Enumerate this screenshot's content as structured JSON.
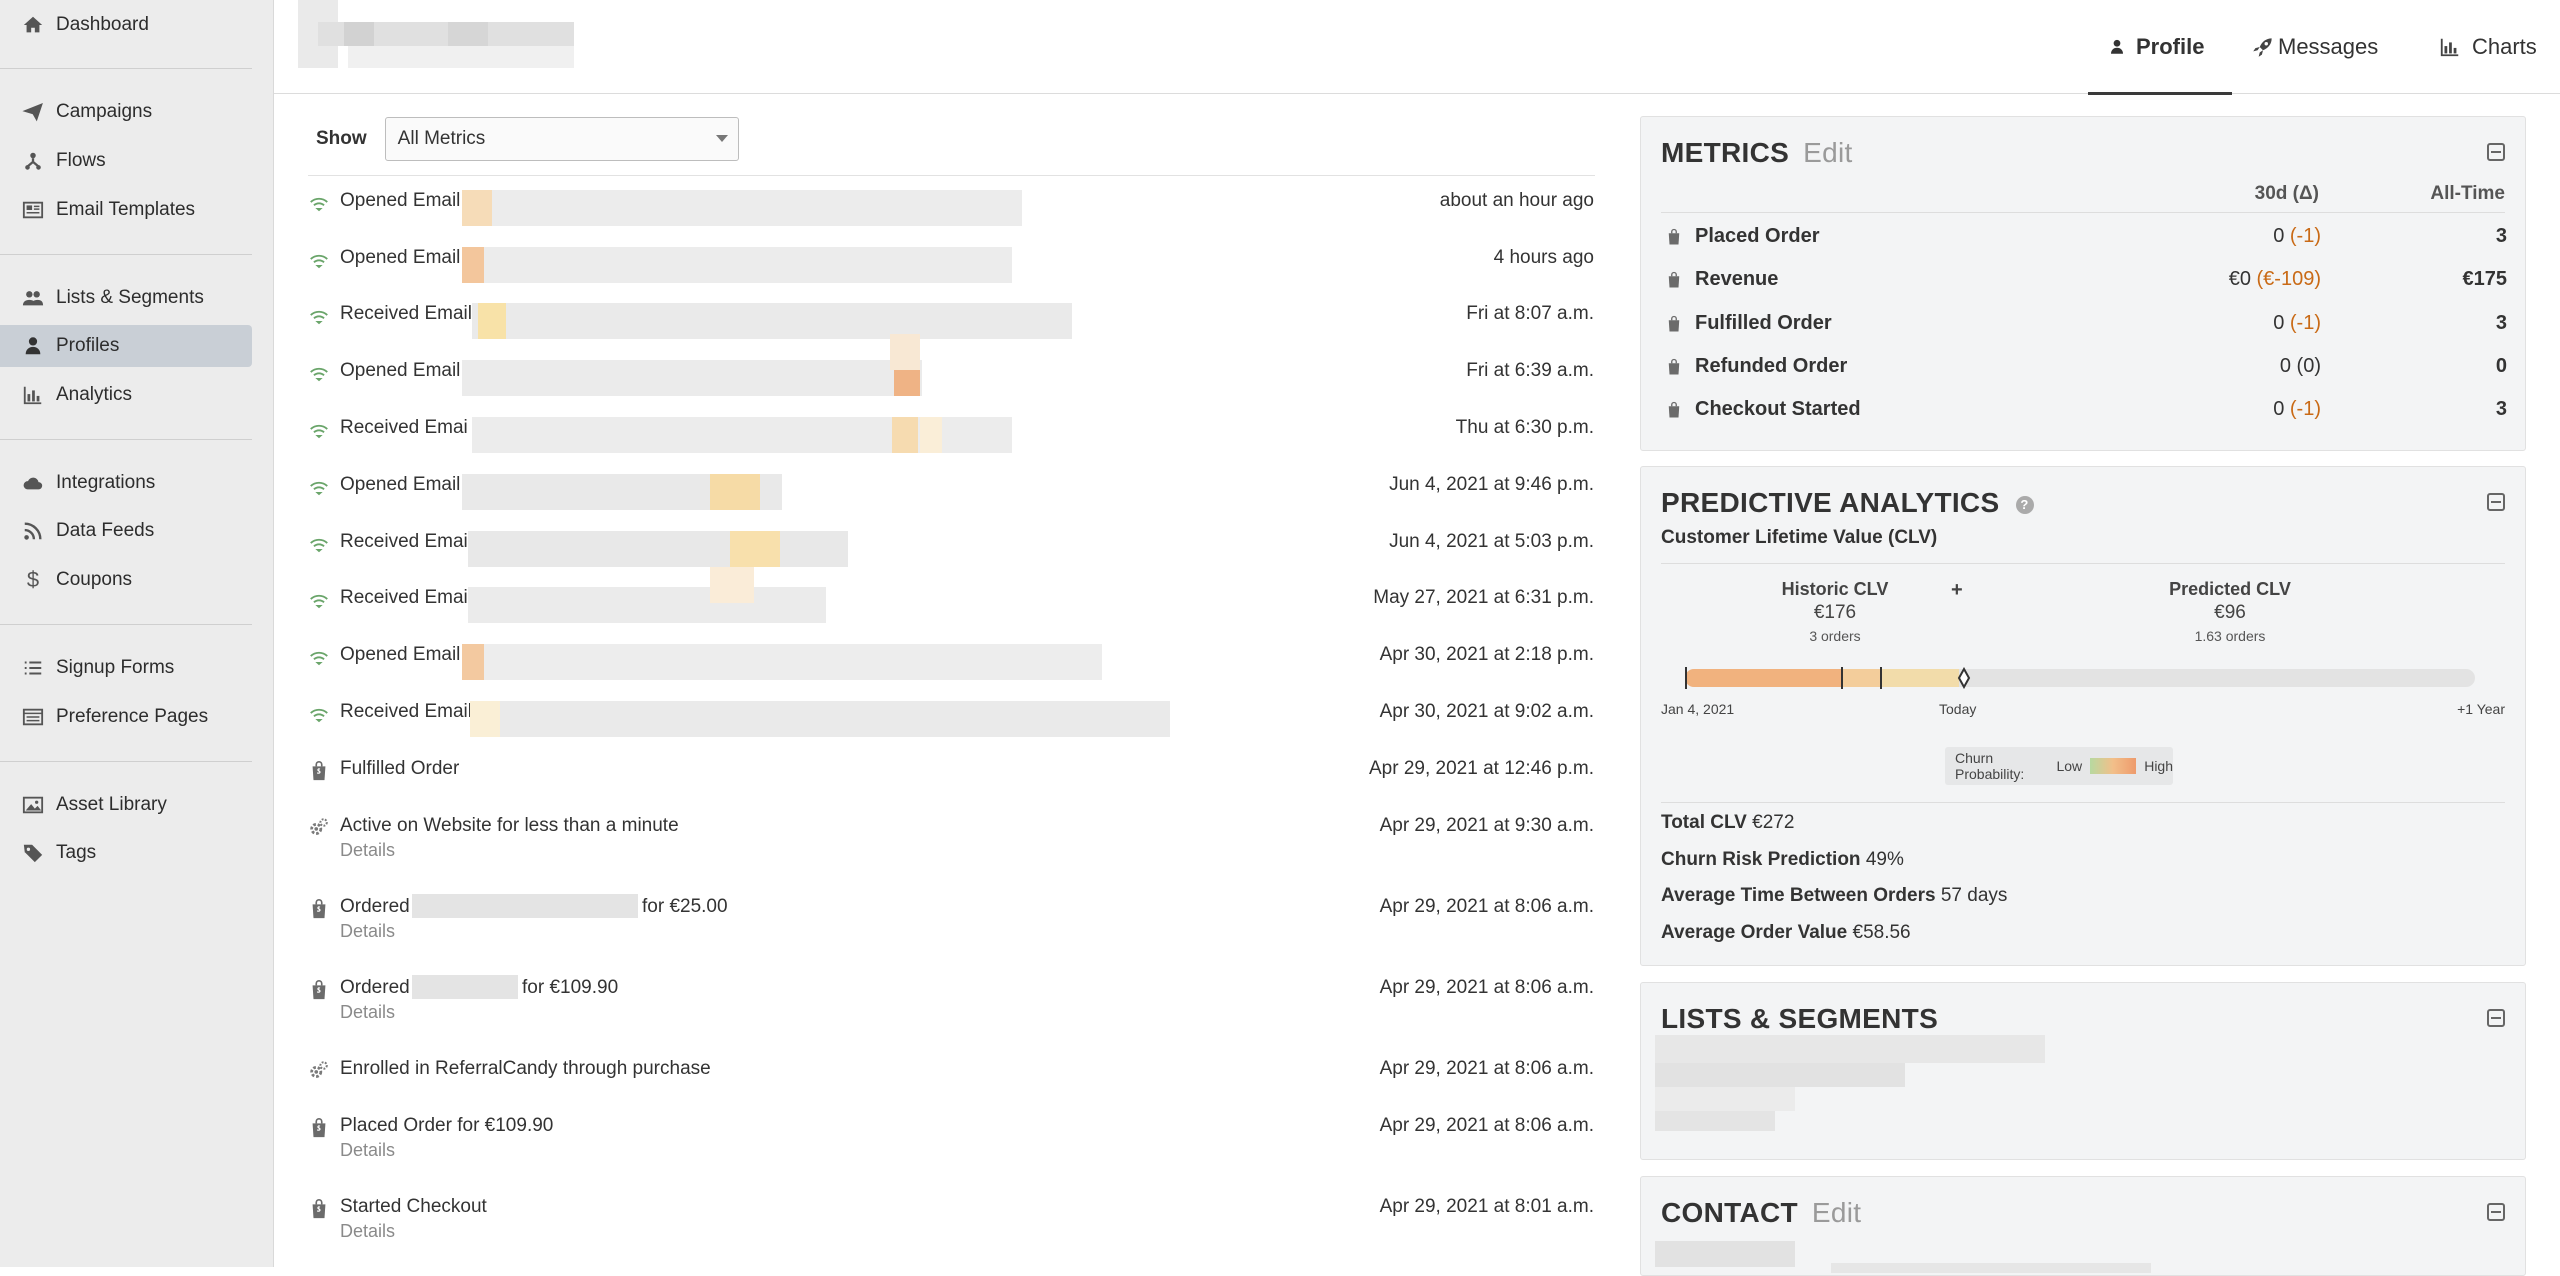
{
  "sidebar": {
    "items": [
      {
        "label": "Dashboard",
        "icon": "home-icon"
      },
      {
        "label": "Campaigns",
        "icon": "paper-plane-icon"
      },
      {
        "label": "Flows",
        "icon": "flows-icon"
      },
      {
        "label": "Email Templates",
        "icon": "newspaper-icon"
      },
      {
        "label": "Lists & Segments",
        "icon": "users-icon"
      },
      {
        "label": "Profiles",
        "icon": "user-icon"
      },
      {
        "label": "Analytics",
        "icon": "bar-chart-icon"
      },
      {
        "label": "Integrations",
        "icon": "cloud-icon"
      },
      {
        "label": "Data Feeds",
        "icon": "rss-icon"
      },
      {
        "label": "Coupons",
        "icon": "dollar-icon"
      },
      {
        "label": "Signup Forms",
        "icon": "list-icon"
      },
      {
        "label": "Preference Pages",
        "icon": "window-icon"
      },
      {
        "label": "Asset Library",
        "icon": "image-icon"
      },
      {
        "label": "Tags",
        "icon": "tag-icon"
      }
    ],
    "active": "Profiles"
  },
  "header": {
    "tabs": [
      {
        "label": "Profile",
        "icon": "user-icon"
      },
      {
        "label": "Messages",
        "icon": "rocket-icon"
      },
      {
        "label": "Charts",
        "icon": "bar-chart-icon"
      }
    ],
    "active_tab": "Profile"
  },
  "feed": {
    "show_label": "Show",
    "metric_filter": "All Metrics",
    "events": [
      {
        "title": "Opened Email",
        "time": "about an hour ago",
        "icon": "email-opened-icon"
      },
      {
        "title": "Opened Email",
        "time": "4 hours ago",
        "icon": "email-opened-icon"
      },
      {
        "title": "Received Email",
        "time": "Fri at 8:07 a.m.",
        "icon": "email-received-icon"
      },
      {
        "title": "Opened Email",
        "time": "Fri at 6:39 a.m.",
        "icon": "email-opened-icon"
      },
      {
        "title": "Received Emai",
        "time": "Thu at 6:30 p.m.",
        "icon": "email-received-icon"
      },
      {
        "title": "Opened Email",
        "time": "Jun 4, 2021 at 9:46 p.m.",
        "icon": "email-opened-icon"
      },
      {
        "title": "Received Email",
        "time": "Jun 4, 2021 at 5:03 p.m.",
        "icon": "email-received-icon"
      },
      {
        "title": "Received Email",
        "time": "May 27, 2021 at 6:31 p.m.",
        "icon": "email-received-icon"
      },
      {
        "title": "Opened Email",
        "time": "Apr 30, 2021 at 2:18 p.m.",
        "icon": "email-opened-icon"
      },
      {
        "title": "Received Email",
        "time": "Apr 30, 2021 at 9:02 a.m.",
        "icon": "email-received-icon"
      },
      {
        "title": "Fulfilled Order",
        "time": "Apr 29, 2021 at 12:46 p.m.",
        "icon": "shopify-icon"
      },
      {
        "title": "Active on Website for less than a minute",
        "time": "Apr 29, 2021 at 9:30 a.m.",
        "details": "Details",
        "icon": "gears-icon"
      },
      {
        "title": "Ordered",
        "title_suffix": "for €25.00",
        "time": "Apr 29, 2021 at 8:06 a.m.",
        "details": "Details",
        "icon": "shopify-icon"
      },
      {
        "title": "Ordered",
        "title_suffix": "for €109.90",
        "time": "Apr 29, 2021 at 8:06 a.m.",
        "details": "Details",
        "icon": "shopify-icon"
      },
      {
        "title": "Enrolled in ReferralCandy through purchase",
        "time": "Apr 29, 2021 at 8:06 a.m.",
        "icon": "gears-icon"
      },
      {
        "title": "Placed Order for €109.90",
        "time": "Apr 29, 2021 at 8:06 a.m.",
        "details": "Details",
        "icon": "shopify-icon"
      },
      {
        "title": "Started Checkout",
        "time": "Apr 29, 2021 at 8:01 a.m.",
        "details": "Details",
        "icon": "shopify-icon"
      }
    ]
  },
  "metrics": {
    "title": "METRICS",
    "edit_label": "Edit",
    "col_30d": "30d (Δ)",
    "col_all": "All-Time",
    "rows": [
      {
        "name": "Placed Order",
        "d30": "0",
        "delta": "(-1)",
        "all": "3",
        "delta_colored": true
      },
      {
        "name": "Revenue",
        "d30": "€0",
        "delta": "(€-109)",
        "all": "€175",
        "delta_colored": true
      },
      {
        "name": "Fulfilled Order",
        "d30": "0",
        "delta": "(-1)",
        "all": "3",
        "delta_colored": true
      },
      {
        "name": "Refunded Order",
        "d30": "0",
        "delta": "(0)",
        "all": "0",
        "delta_colored": false
      },
      {
        "name": "Checkout Started",
        "d30": "0",
        "delta": "(-1)",
        "all": "3",
        "delta_colored": true
      }
    ]
  },
  "predictive": {
    "title": "PREDICTIVE ANALYTICS",
    "subtitle": "Customer Lifetime Value (CLV)",
    "historic_label": "Historic CLV",
    "historic_value": "€176",
    "historic_orders": "3 orders",
    "plus": "+",
    "predicted_label": "Predicted CLV",
    "predicted_value": "€96",
    "predicted_orders": "1.63 orders",
    "timeline_start": "Jan 4, 2021",
    "timeline_mid": "Today",
    "timeline_end": "+1 Year",
    "churn_label": "Churn Probability:",
    "churn_low": "Low",
    "churn_high": "High",
    "stats": [
      {
        "label": "Total CLV",
        "value": "€272"
      },
      {
        "label": "Churn Risk Prediction",
        "value": "49%"
      },
      {
        "label": "Average Time Between Orders",
        "value": "57 days"
      },
      {
        "label": "Average Order Value",
        "value": "€58.56"
      }
    ]
  },
  "lists_segments": {
    "title": "LISTS & SEGMENTS"
  },
  "contact": {
    "title": "CONTACT",
    "edit_label": "Edit"
  },
  "colors": {
    "sidebar_bg": "#ececec",
    "active_nav": "#c9cfd6",
    "panel_bg": "#f3f4f5",
    "delta_orange": "#c96a16",
    "clv_historic": "#f1b27e",
    "clv_predicted": "#f2dcaa",
    "email_icon_green": "#6aa56a"
  }
}
